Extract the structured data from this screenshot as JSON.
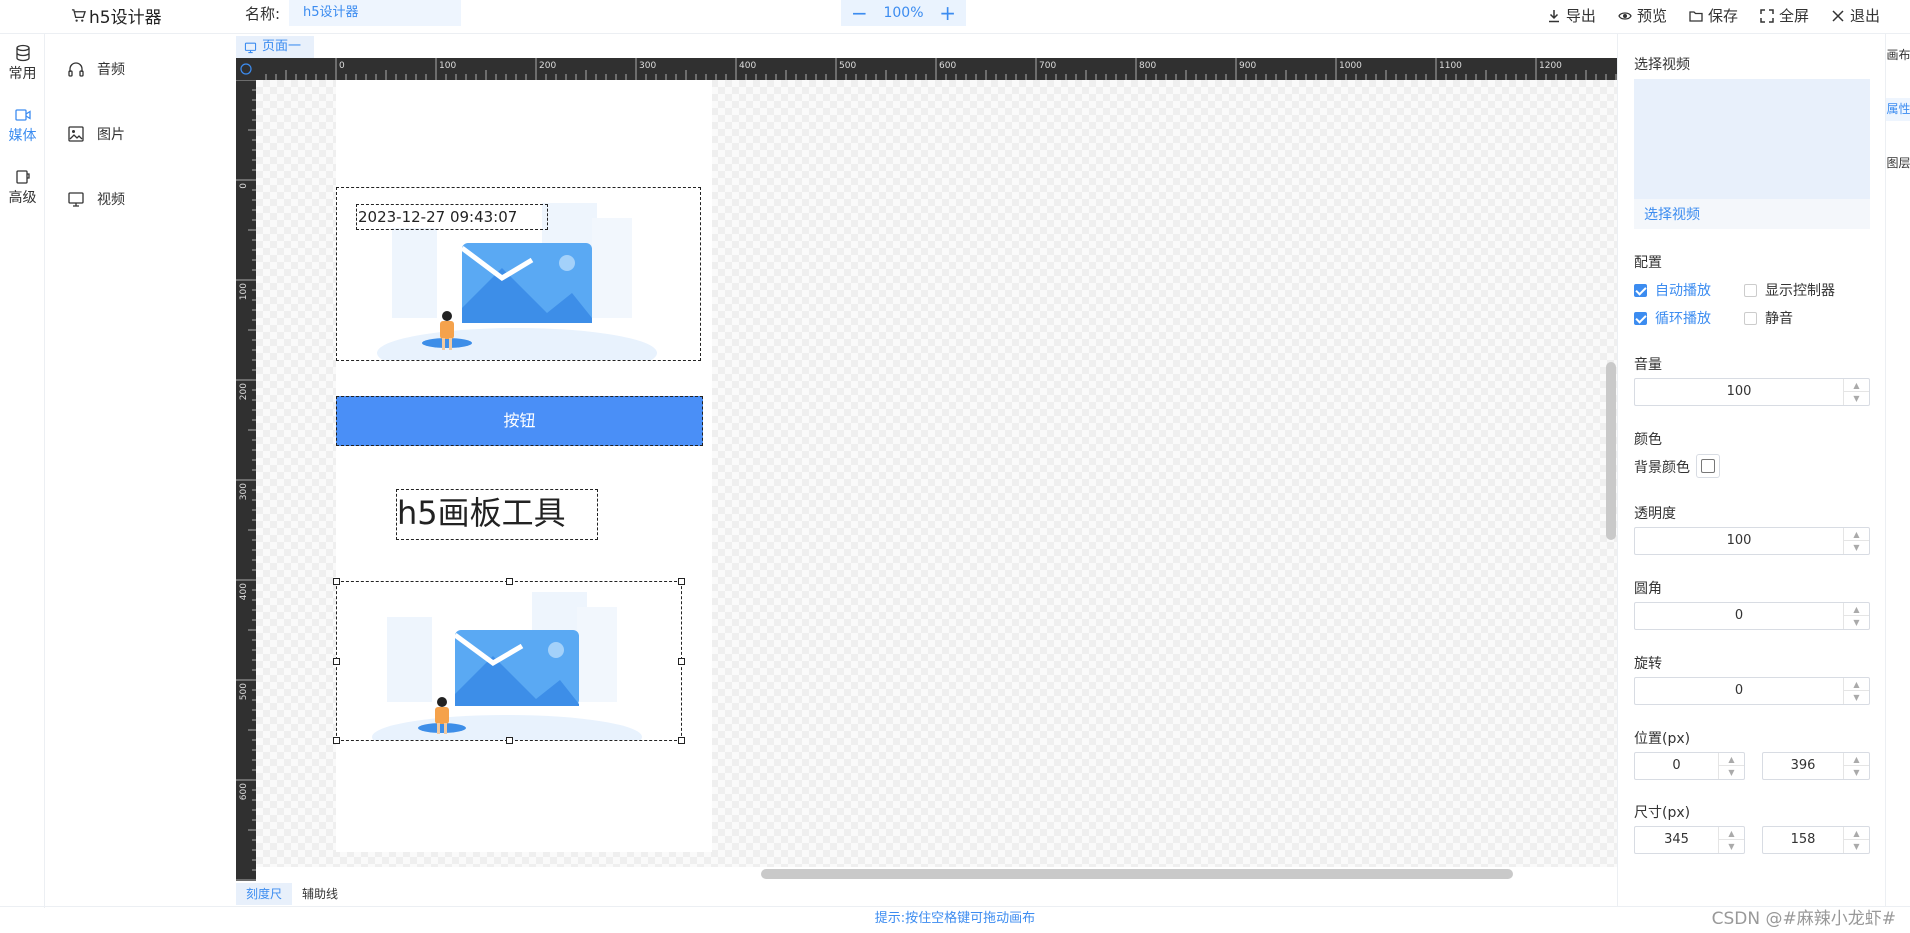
{
  "header": {
    "app_title": "h5设计器",
    "name_label": "名称:",
    "name_value": "h5设计器",
    "zoom_value": "100%",
    "zoom_out": "−",
    "zoom_in": "+",
    "actions": [
      {
        "label": "导出",
        "icon": "download-icon"
      },
      {
        "label": "预览",
        "icon": "eye-icon"
      },
      {
        "label": "保存",
        "icon": "folder-icon"
      },
      {
        "label": "全屏",
        "icon": "fullscreen-icon"
      },
      {
        "label": "退出",
        "icon": "close-icon"
      }
    ]
  },
  "left_nav": {
    "items": [
      {
        "label": "常用",
        "icon": "database-icon",
        "active": false
      },
      {
        "label": "媒体",
        "icon": "video-camera-icon",
        "active": true
      },
      {
        "label": "高级",
        "icon": "cup-icon",
        "active": false
      }
    ],
    "sub_items": [
      {
        "label": "音频",
        "icon": "headphones-icon"
      },
      {
        "label": "图片",
        "icon": "image-icon"
      },
      {
        "label": "视频",
        "icon": "monitor-icon"
      }
    ]
  },
  "page_tab": "页面一",
  "ruler": {
    "top_labels": [
      "0",
      "100",
      "200",
      "300",
      "400",
      "500",
      "600",
      "700",
      "800",
      "900",
      "1000",
      "1100",
      "1200"
    ],
    "left_labels": [
      "0",
      "100",
      "200",
      "300",
      "400",
      "500",
      "600"
    ]
  },
  "stage": {
    "timestamp": "2023-12-27 09:43:07",
    "button_label": "按钮",
    "text_content": "h5画板工具"
  },
  "bottom_tabs": [
    {
      "label": "刻度尺",
      "active": true
    },
    {
      "label": "辅助线",
      "active": false
    }
  ],
  "status_hint": "提示:按住空格键可拖动画布",
  "watermark": "CSDN @#麻辣小龙虾#",
  "right_tabs": [
    {
      "label": "画布",
      "active": false
    },
    {
      "label": "属性",
      "active": true
    },
    {
      "label": "图层",
      "active": false
    }
  ],
  "props": {
    "video_section_label": "选择视频",
    "video_select_button": "选择视频",
    "config_label": "配置",
    "checkboxes": [
      {
        "label": "自动播放",
        "checked": true
      },
      {
        "label": "显示控制器",
        "checked": false
      },
      {
        "label": "循环播放",
        "checked": true
      },
      {
        "label": "静音",
        "checked": false
      }
    ],
    "volume_label": "音量",
    "volume_value": "100",
    "color_label": "颜色",
    "bg_color_label": "背景颜色",
    "opacity_label": "透明度",
    "opacity_value": "100",
    "radius_label": "圆角",
    "radius_value": "0",
    "rotate_label": "旋转",
    "rotate_value": "0",
    "position_label": "位置(px)",
    "pos_x": "0",
    "pos_y": "396",
    "size_label": "尺寸(px)",
    "width": "345",
    "height": "158"
  },
  "colors": {
    "accent": "#3c8cf0",
    "button_fill": "#4a8ff7",
    "ruler_bg": "#303030"
  }
}
